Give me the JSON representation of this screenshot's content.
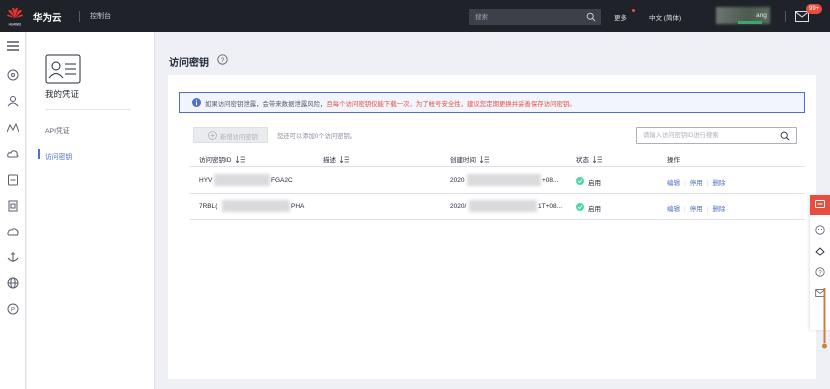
{
  "topbar": {
    "logo_text": "HUAWEI",
    "brand": "华为云",
    "console": "控制台",
    "search_placeholder": "搜索",
    "more": "更多",
    "language": "中文 (简体)",
    "user_name_partial": "ang",
    "mail_badge": "99+"
  },
  "subnav": {
    "title": "我的凭证",
    "items": [
      {
        "label": "API凭证",
        "active": false
      },
      {
        "label": "访问密钥",
        "active": true
      }
    ]
  },
  "main": {
    "page_title": "访问密钥",
    "notice_prefix": "如果访问密钥泄露，会带来数据泄露风险，",
    "notice_highlight": "且每个访问密钥仅能下载一次，为了帐号安全性，建议您定期更换并妥善保存访问密钥。",
    "new_button": "新增访问密钥",
    "hint": "您还可以添加0个访问密钥。",
    "search_placeholder": "请输入访问密钥ID进行搜索",
    "columns": {
      "id": "访问密钥ID",
      "desc": "描述",
      "created": "创建时间",
      "status": "状态",
      "ops": "操作"
    },
    "rows": [
      {
        "id_start": "HYV",
        "id_end": "FGA2C",
        "desc": "",
        "created_start": "2020",
        "created_end": "+08...",
        "status": "启用",
        "op_edit": "编辑",
        "op_disable": "停用",
        "op_delete": "删除"
      },
      {
        "id_start": "7RBL(",
        "id_end": "PHA",
        "desc": "",
        "created_start": "2020/",
        "created_end": "1T+08...",
        "status": "启用",
        "op_edit": "编辑",
        "op_disable": "停用",
        "op_delete": "删除"
      }
    ]
  },
  "colors": {
    "topbar_bg": "#1f2329",
    "accent": "#526ecc",
    "danger": "#e84e40",
    "success": "#50d4ab"
  }
}
